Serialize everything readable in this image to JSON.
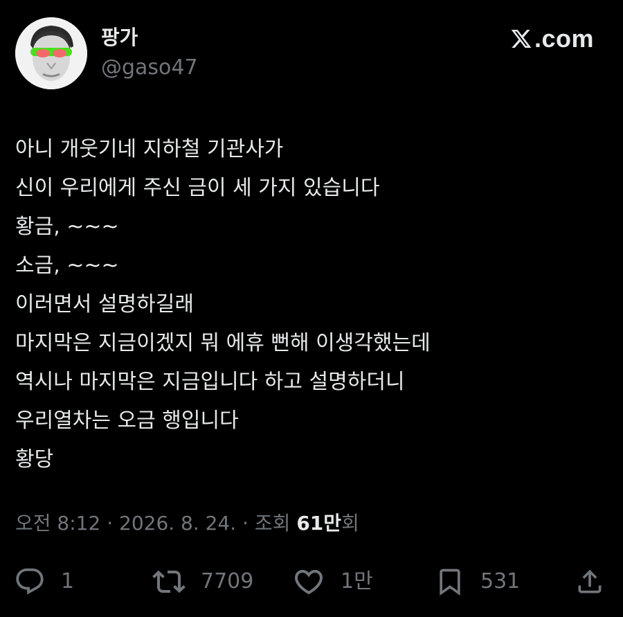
{
  "author": {
    "display_name": "팡가",
    "handle": "@gaso47",
    "avatar_icon": "profile-avatar"
  },
  "brand": {
    "icon": "x-logo-icon",
    "text": ".com"
  },
  "tweet": {
    "lines": [
      "아니 개웃기네 지하철 기관사가",
      "신이 우리에게 주신 금이 세 가지 있습니다",
      "황금, ~~~",
      "소금, ~~~",
      "이러면서 설명하길래",
      "마지막은 지금이겠지 뭐 에휴 뻔해 이생각했는데",
      "역시나 마지막은 지금입니다 하고 설명하더니",
      "우리열차는 오금 행입니다",
      "황당"
    ]
  },
  "meta": {
    "timestamp": "오전 8:12 · 2026. 8. 24. · 조회 ",
    "views_count": "61만",
    "views_suffix": "회"
  },
  "actions": {
    "reply": {
      "icon": "reply-icon",
      "count": "1"
    },
    "retweet": {
      "icon": "retweet-icon",
      "count": "7709"
    },
    "like": {
      "icon": "heart-icon",
      "count": "1만"
    },
    "bookmark": {
      "icon": "bookmark-icon",
      "count": "531"
    },
    "share": {
      "icon": "share-icon"
    }
  },
  "colors": {
    "background": "#000000",
    "primary_text": "#e7e9ea",
    "secondary_text": "#71767b"
  }
}
